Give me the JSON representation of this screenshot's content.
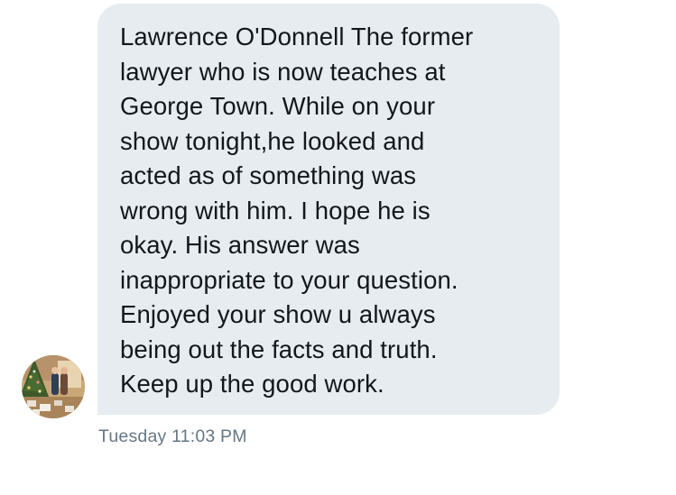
{
  "message": {
    "text": "Lawrence O'Donnell  The former\nlawyer who is now teaches at\nGeorge Town. While on your\nshow tonight,he looked and\nacted as of something was\nwrong with him. I hope he is\nokay. His answer was\ninappropriate to your question.\nEnjoyed your show u always\nbeing out the facts and truth.\nKeep up the good work.",
    "timestamp": "Tuesday 11:03 PM"
  },
  "sender": {
    "avatar_icon": "profile-photo-avatar"
  },
  "colors": {
    "bubble_background": "#e6ecf0",
    "message_text": "#14171a",
    "timestamp_text": "#657786"
  }
}
